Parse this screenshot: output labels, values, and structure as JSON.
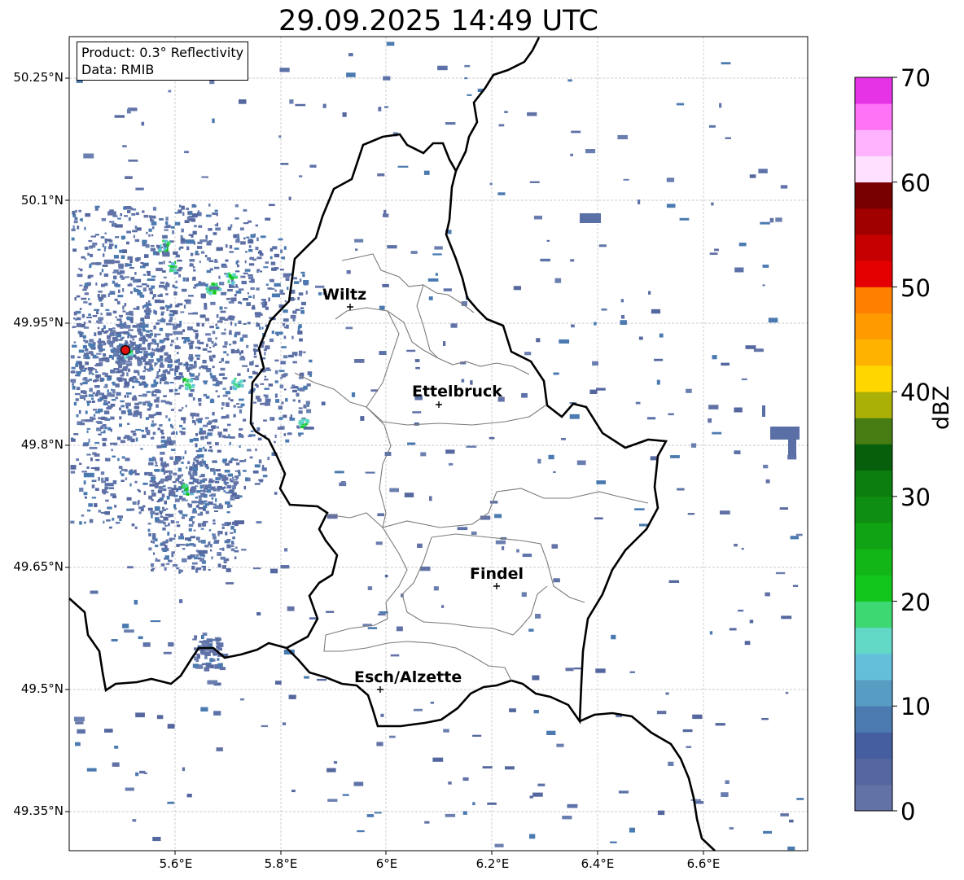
{
  "title": "29.09.2025 14:49 UTC",
  "info": {
    "product": "Product: 0.3° Reflectivity",
    "data": "Data: RMIB"
  },
  "lat_labels": [
    "50.25°N",
    "50.1°N",
    "49.95°N",
    "49.8°N",
    "49.65°N",
    "49.5°N",
    "49.35°N"
  ],
  "lon_labels": [
    "5.6°E",
    "5.8°E",
    "6°E",
    "6.2°E",
    "6.4°E",
    "6.6°E"
  ],
  "cities": [
    {
      "name": "Wiltz"
    },
    {
      "name": "Ettelbruck"
    },
    {
      "name": "Findel"
    },
    {
      "name": "Esch/Alzette"
    }
  ],
  "colorbar": {
    "label": "dBZ",
    "ticks": [
      "70",
      "60",
      "50",
      "40",
      "30",
      "20",
      "10",
      "0"
    ],
    "range": [
      0,
      70
    ],
    "colors": [
      "#6272a6",
      "#54679f",
      "#455e9f",
      "#4a7ab0",
      "#579cc2",
      "#64bfda",
      "#62d8c6",
      "#3ed872",
      "#13c61b",
      "#12b617",
      "#10a313",
      "#0f8f12",
      "#0c7d0f",
      "#075f0b",
      "#467c11",
      "#abb006",
      "#ffd600",
      "#ffb300",
      "#ff9b00",
      "#ff7f00",
      "#e40000",
      "#c60000",
      "#a00000",
      "#780000",
      "#ffe0ff",
      "#ffb3ff",
      "#ff73f7",
      "#e633e6"
    ]
  },
  "extent": {
    "lon": [
      5.4,
      6.8
    ],
    "lat": [
      49.3,
      50.3
    ]
  },
  "radar_site": {
    "lon": 5.505,
    "lat": 49.915,
    "color": "#e01010"
  }
}
